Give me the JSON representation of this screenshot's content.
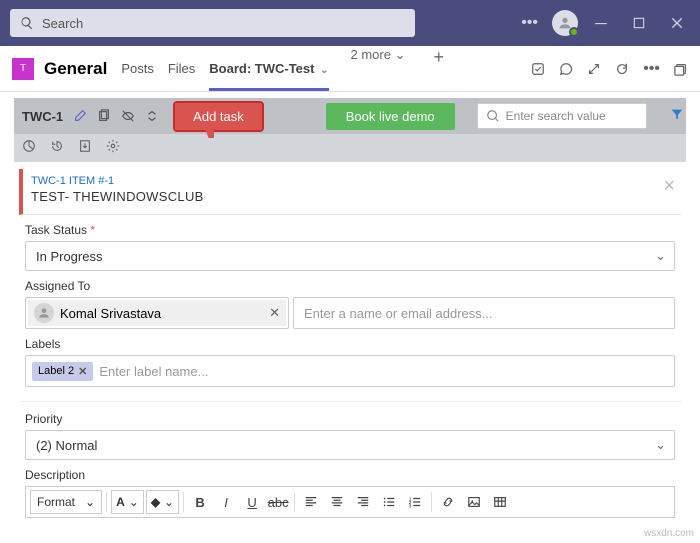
{
  "titlebar": {
    "search_placeholder": "Search"
  },
  "channel": {
    "team_initial": "T",
    "name": "General",
    "tabs": {
      "posts": "Posts",
      "files": "Files",
      "board": "Board: TWC-Test",
      "more": "2 more"
    }
  },
  "toolbar": {
    "project": "TWC-1",
    "add_task": "Add task",
    "book_demo": "Book live demo",
    "search_placeholder": "Enter search value"
  },
  "item": {
    "id": "TWC-1 ITEM #-1",
    "title": "TEST- THEWINDOWSCLUB"
  },
  "fields": {
    "status_label": "Task Status",
    "status_value": "In Progress",
    "assigned_label": "Assigned To",
    "assignee_name": "Komal Srivastava",
    "assignee_placeholder": "Enter a name or email address...",
    "labels_label": "Labels",
    "label_chip": "Label 2",
    "labels_placeholder": "Enter label name...",
    "priority_label": "Priority",
    "priority_value": "(2) Normal",
    "description_label": "Description",
    "format_label": "Format",
    "font_letter": "A",
    "fill_letter": "◇"
  },
  "watermark": "wsxdn.com"
}
